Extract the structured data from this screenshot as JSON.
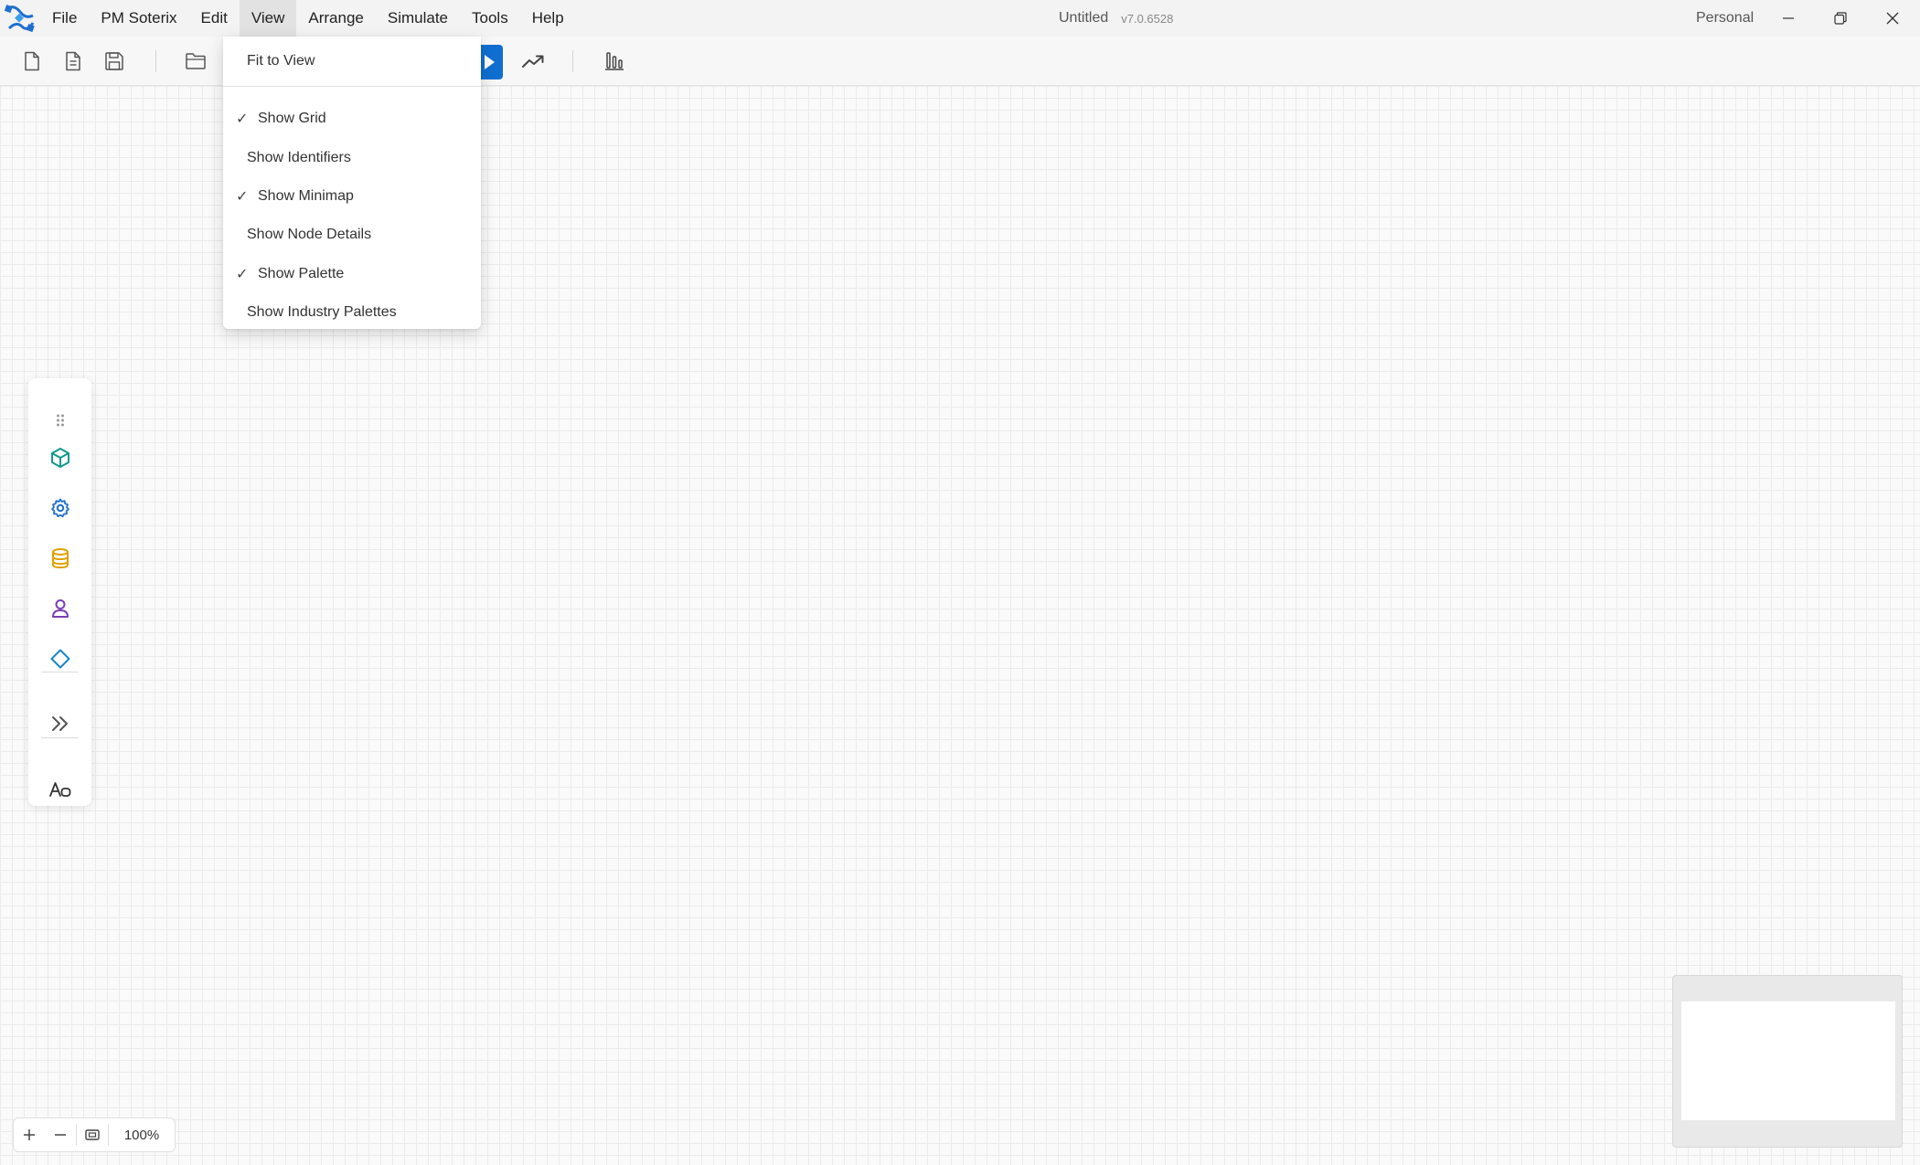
{
  "titlebar": {
    "logo_icon": "pm-soterix-logo-icon",
    "menu": [
      "File",
      "PM Soterix",
      "Edit",
      "View",
      "Arrange",
      "Simulate",
      "Tools",
      "Help"
    ],
    "active_menu": "View",
    "document_title": "Untitled",
    "version": "v7.0.6528",
    "account": "Personal",
    "window_controls": [
      "minimize-icon",
      "restore-icon",
      "close-icon"
    ]
  },
  "toolbar": {
    "buttons": [
      "new-file-icon",
      "new-document-icon",
      "save-icon",
      "open-folder-icon",
      "run-icon",
      "trend-chart-icon",
      "bar-chart-icon"
    ],
    "run_color": "#0f6fd1"
  },
  "view_menu": {
    "top_item": "Fit to View",
    "items": [
      {
        "label": "Show Grid",
        "checked": true
      },
      {
        "label": "Show Identifiers",
        "checked": false
      },
      {
        "label": "Show Minimap",
        "checked": true
      },
      {
        "label": "Show Node Details",
        "checked": false
      },
      {
        "label": "Show Palette",
        "checked": true
      },
      {
        "label": "Show Industry Palettes",
        "checked": false
      }
    ],
    "check_mark": "✓"
  },
  "palette": {
    "items": [
      {
        "icon": "drag-handle-icon",
        "color": "#999999"
      },
      {
        "icon": "cube-icon",
        "color": "#0f9a8a"
      },
      {
        "icon": "gear-icon",
        "color": "#1f6fd0"
      },
      {
        "icon": "database-icon",
        "color": "#e0a100"
      },
      {
        "icon": "person-icon",
        "color": "#7b3fb5"
      },
      {
        "icon": "decision-diamond-icon",
        "color": "#1a86c9"
      },
      {
        "icon": "double-chevron-right-icon",
        "color": "#555555"
      },
      {
        "icon": "text-style-icon",
        "color": "#333333"
      }
    ]
  },
  "zoom": {
    "zoom_in_icon": "plus-icon",
    "zoom_out_icon": "minus-icon",
    "fit_icon": "fit-screen-icon",
    "level": "100%"
  },
  "minimap": {
    "visible": true
  }
}
